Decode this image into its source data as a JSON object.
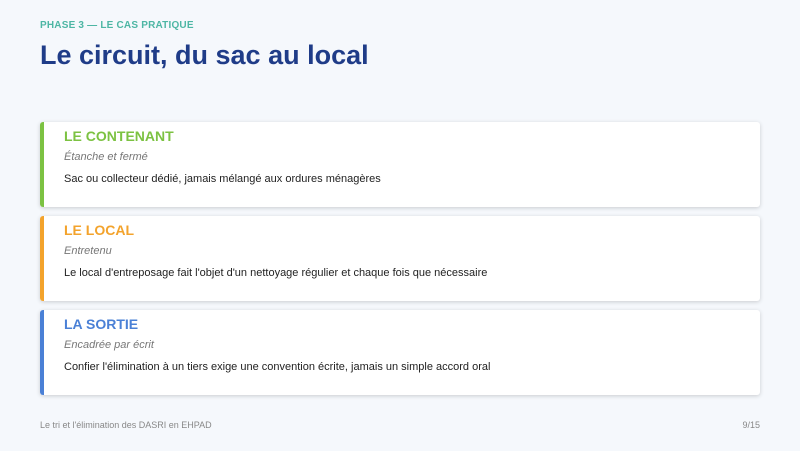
{
  "header": {
    "phase": "PHASE 3 — LE CAS PRATIQUE",
    "title": "Le circuit, du sac au local"
  },
  "cards": [
    {
      "title": "LE CONTENANT",
      "subtitle": "Étanche et fermé",
      "description": "Sac ou collecteur dédié, jamais mélangé aux ordures ménagères",
      "color": "#7cc242"
    },
    {
      "title": "LE LOCAL",
      "subtitle": "Entretenu",
      "description": "Le local d'entreposage fait l'objet d'un nettoyage régulier et chaque fois que nécessaire",
      "color": "#f3a32c"
    },
    {
      "title": "LA SORTIE",
      "subtitle": "Encadrée par écrit",
      "description": "Confier l'élimination à un tiers exige une convention écrite, jamais un simple accord oral",
      "color": "#4a80d6"
    }
  ],
  "footer": {
    "left": "Le tri et l'élimination des DASRI en EHPAD",
    "page": "9/15"
  }
}
